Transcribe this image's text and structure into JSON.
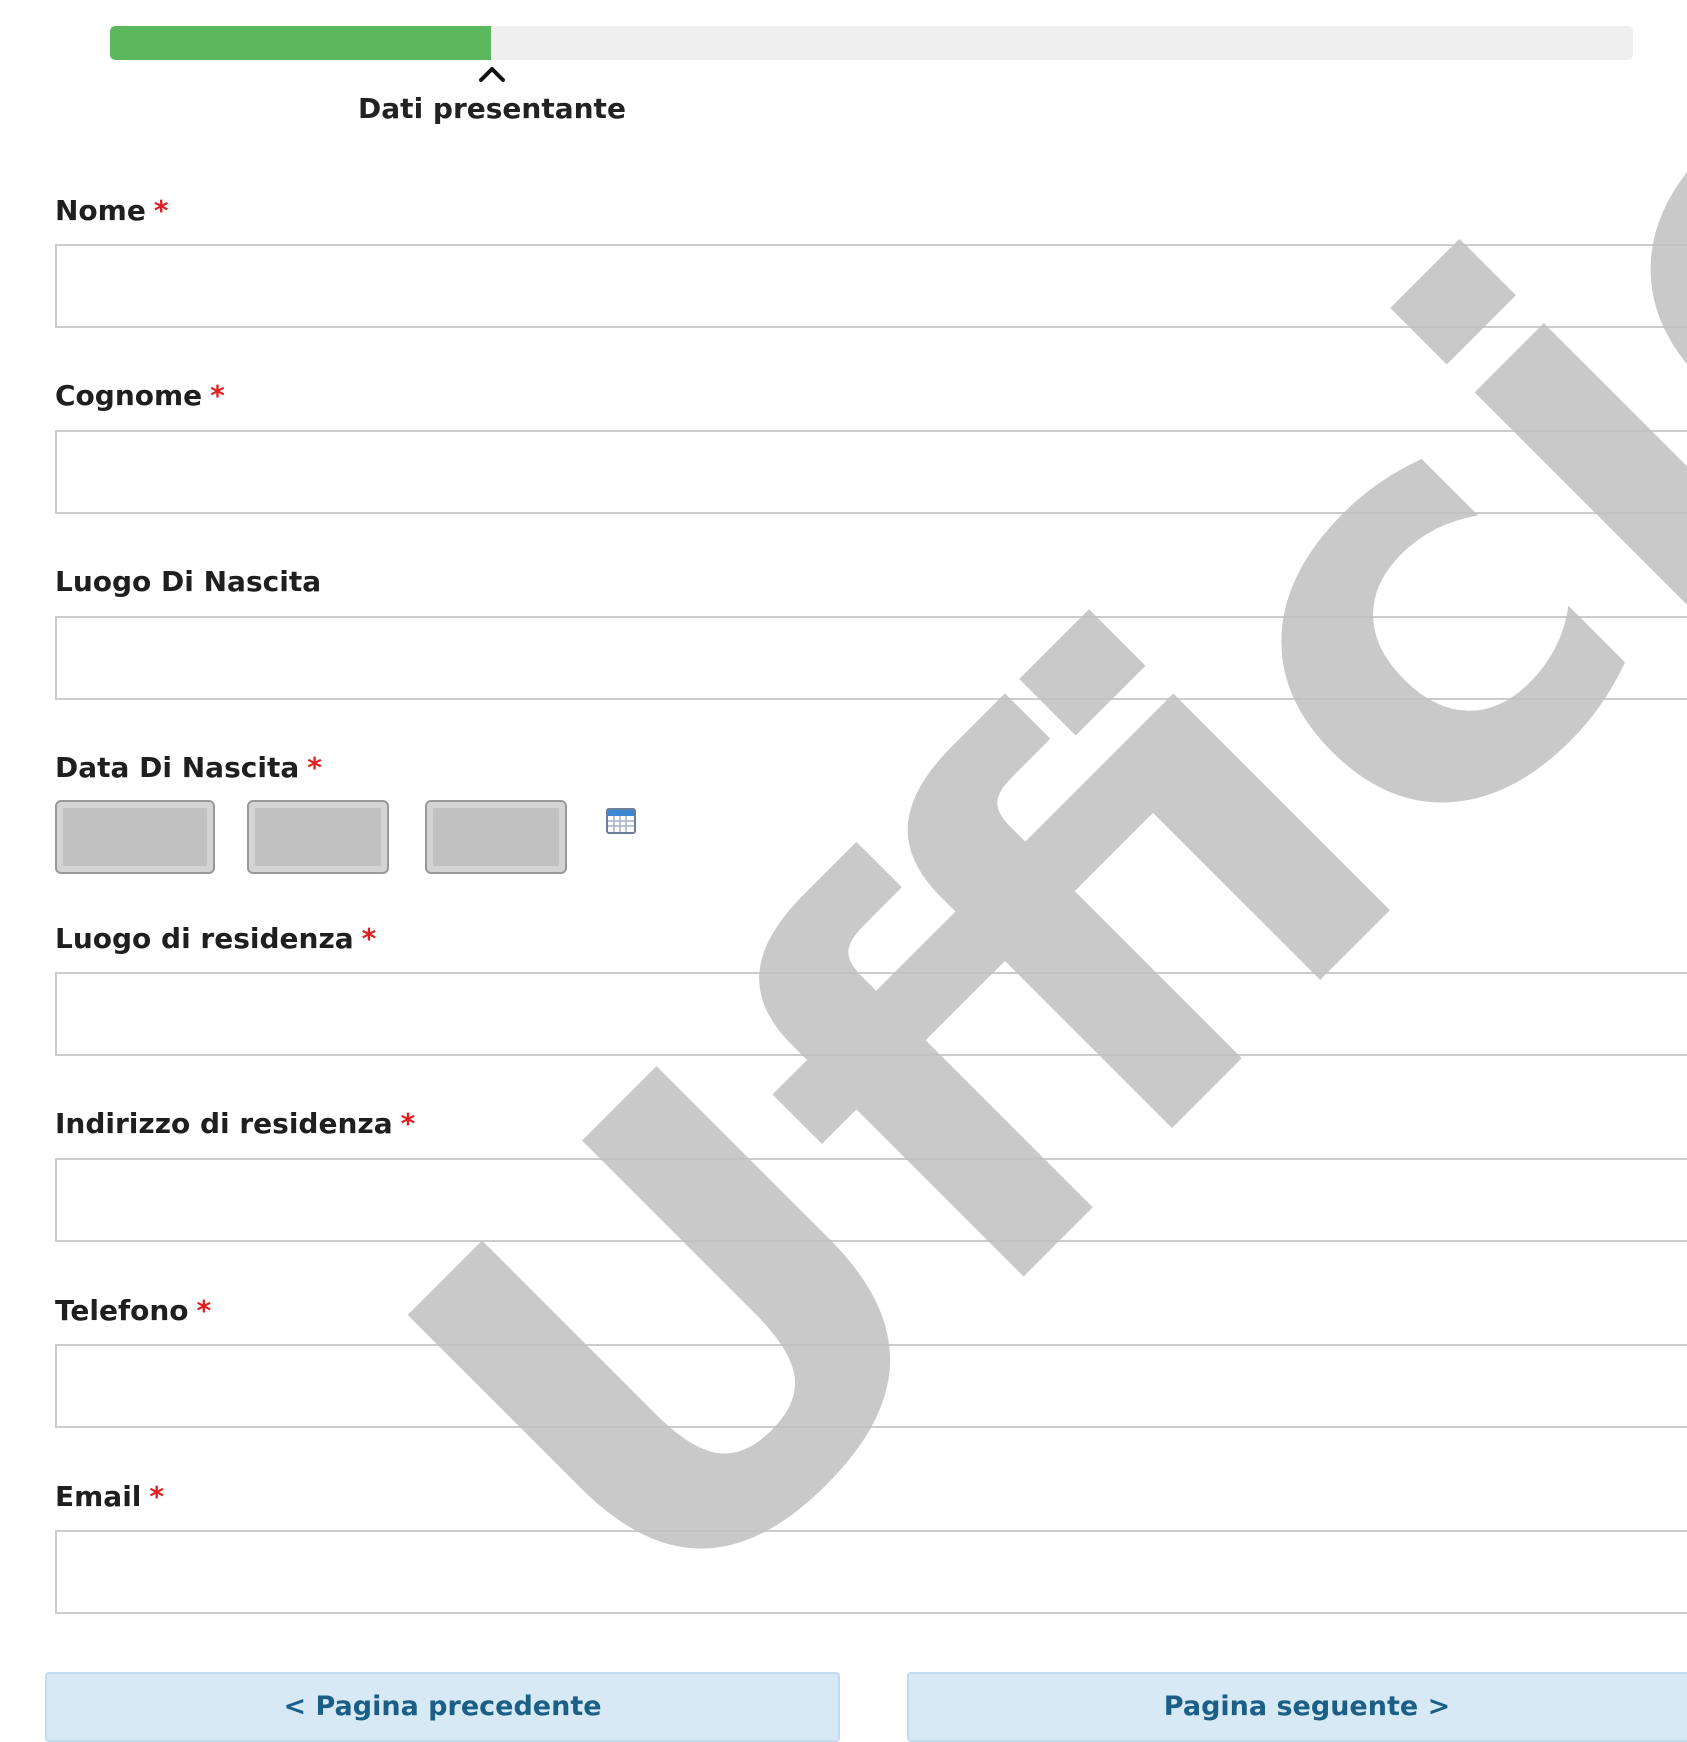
{
  "progress": {
    "percent": 25,
    "step_label": "Dati presentante",
    "fill_color": "#5cb85c",
    "caret_icon": "caret-up-icon"
  },
  "form": {
    "required_marker": "*",
    "fields": {
      "nome": {
        "label": "Nome",
        "required": true,
        "value": ""
      },
      "cognome": {
        "label": "Cognome",
        "required": true,
        "value": ""
      },
      "luogo_nascita": {
        "label": "Luogo Di Nascita",
        "required": false,
        "value": ""
      },
      "data_nascita": {
        "label": "Data Di Nascita",
        "required": true,
        "calendar_icon": "calendar-icon"
      },
      "luogo_residenza": {
        "label": "Luogo di residenza",
        "required": true,
        "value": ""
      },
      "indirizzo_residenza": {
        "label": "Indirizzo di residenza",
        "required": true,
        "value": ""
      },
      "telefono": {
        "label": "Telefono",
        "required": true,
        "value": ""
      },
      "email": {
        "label": "Email",
        "required": true,
        "value": ""
      }
    }
  },
  "navigation": {
    "prev_label": "< Pagina precedente",
    "next_label": "Pagina seguente >"
  },
  "watermark": {
    "text": "Ufficio"
  },
  "colors": {
    "required": "#e02020",
    "button_bg": "#d6e9f5",
    "button_text": "#1b5f86"
  }
}
